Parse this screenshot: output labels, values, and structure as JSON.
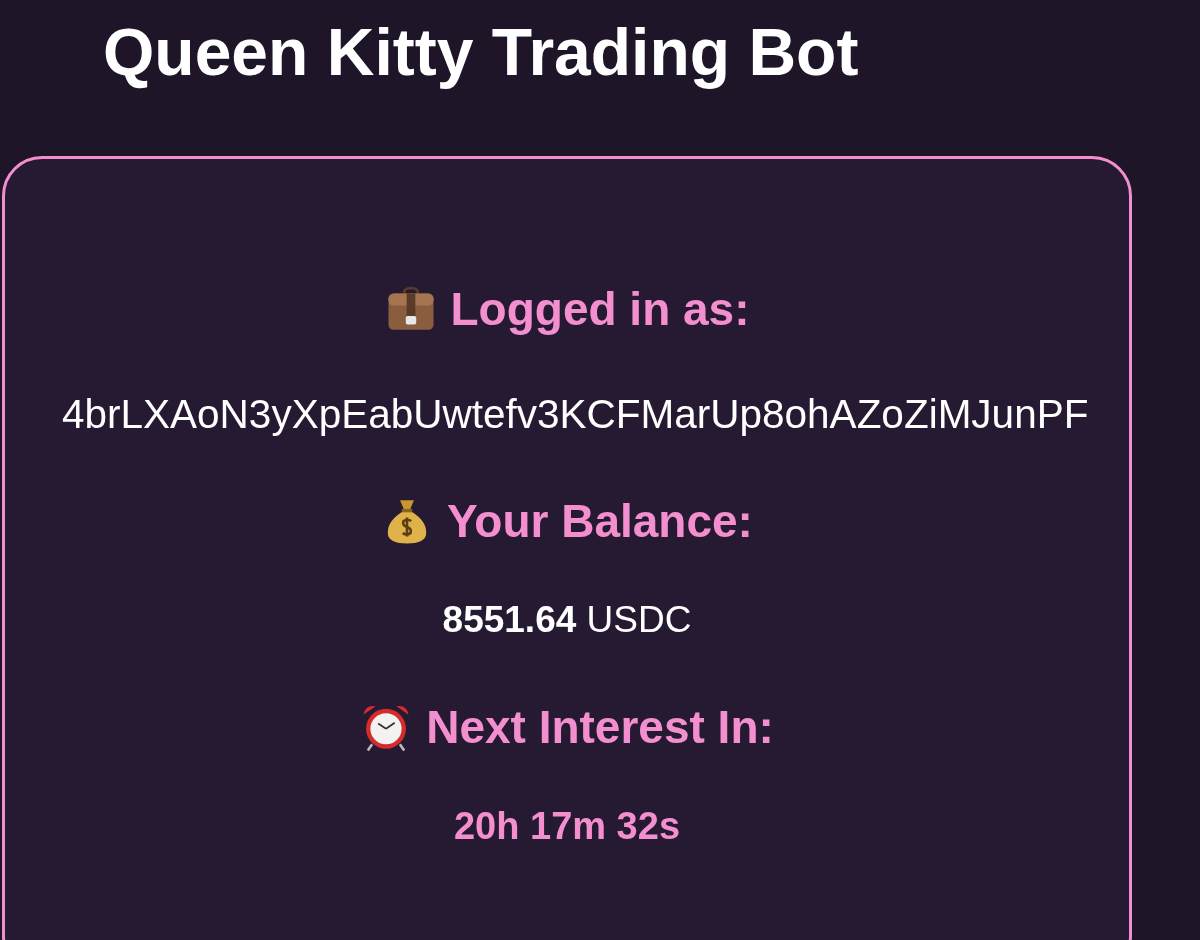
{
  "title": "Queen Kitty Trading Bot",
  "card": {
    "sections": [
      {
        "heading": "Logged in as:",
        "value": "4brLXAoN3yXpEabUwtefv3KCFMarUp8ohAZoZiMJunPF",
        "kind": "address"
      },
      {
        "heading": "Your Balance:",
        "value": "**8551.64** USDC",
        "kind": "balance"
      },
      {
        "heading": "Next Interest In:",
        "value": "20h 17m 32s",
        "kind": "timer"
      }
    ]
  }
}
